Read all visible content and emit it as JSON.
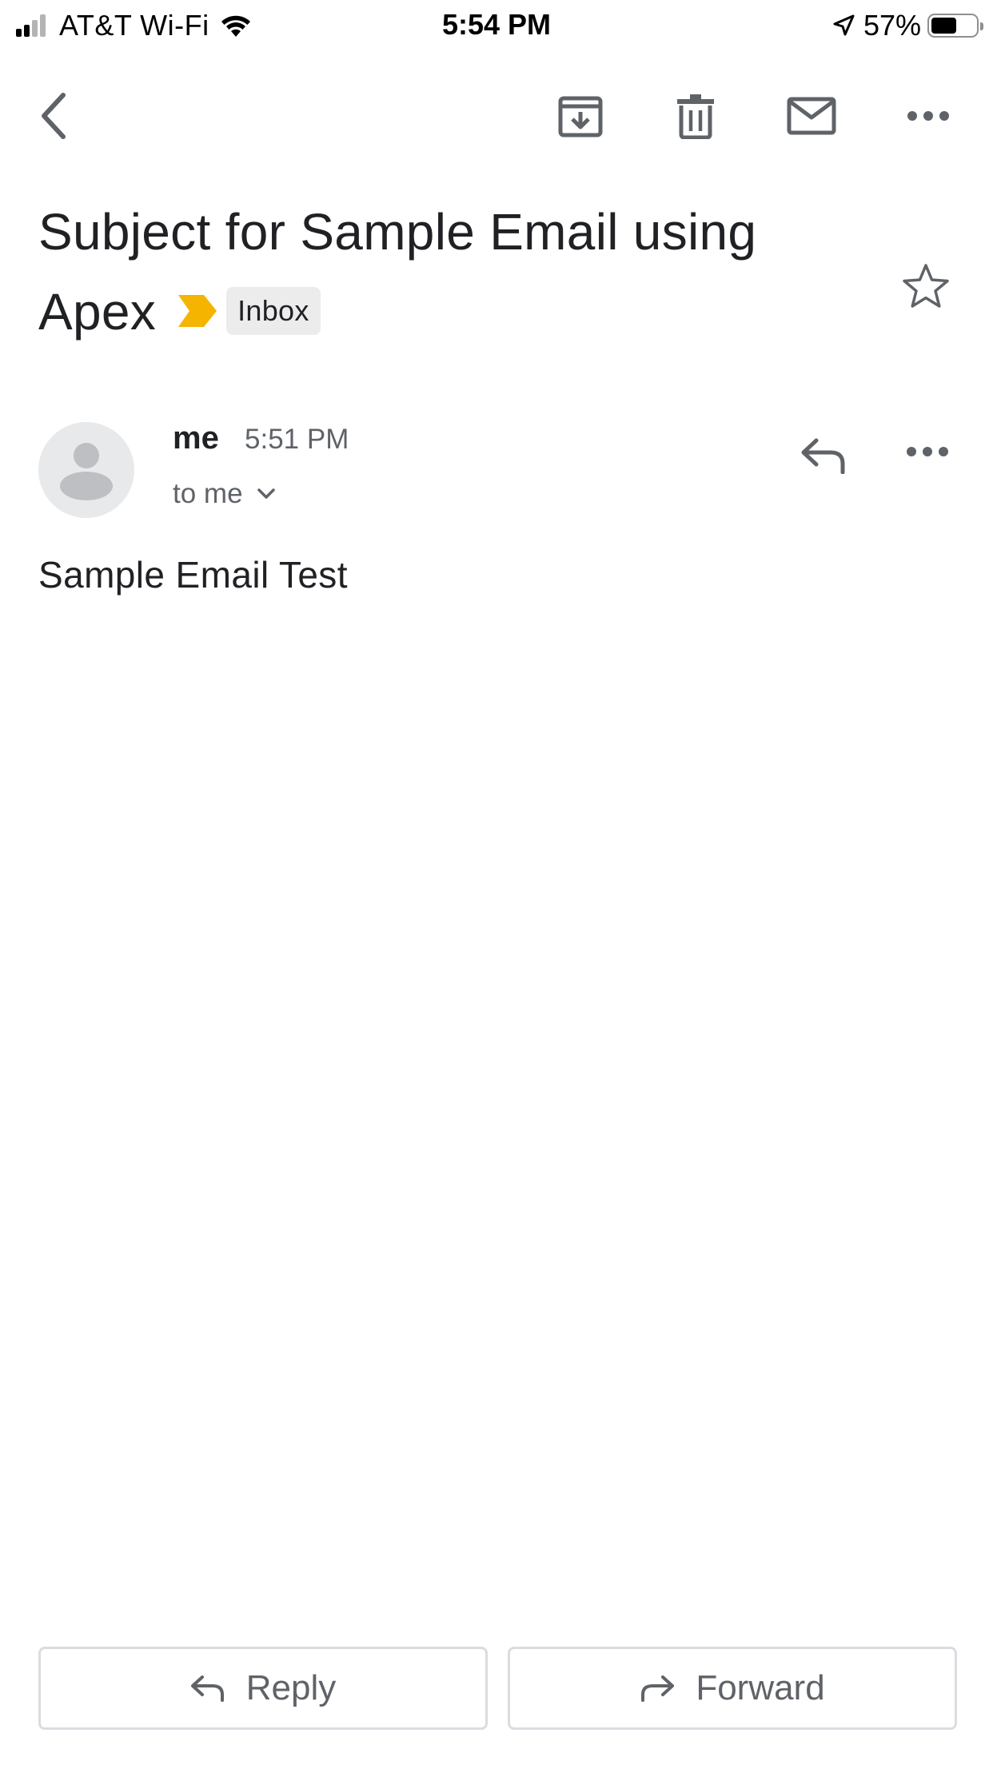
{
  "status_bar": {
    "carrier": "AT&T Wi-Fi",
    "time": "5:54 PM",
    "battery_percent": "57%",
    "battery_level": 0.57,
    "signal_bars_active": 2,
    "signal_bars_total": 4
  },
  "toolbar": {
    "back_icon": "chevron-left-icon",
    "archive_icon": "archive-icon",
    "delete_icon": "trash-icon",
    "mark_unread_icon": "mail-icon",
    "more_icon": "more-horizontal-icon"
  },
  "email": {
    "subject": "Subject for Sample Email using Apex",
    "label": "Inbox",
    "important_color": "#f4b400",
    "starred": false,
    "sender": "me",
    "time": "5:51 PM",
    "recipients": "to me",
    "body": "Sample Email Test"
  },
  "actions": {
    "reply_label": "Reply",
    "forward_label": "Forward"
  },
  "colors": {
    "icon_gray": "#5f6368",
    "text_primary": "#202124",
    "border": "#dadce0"
  }
}
